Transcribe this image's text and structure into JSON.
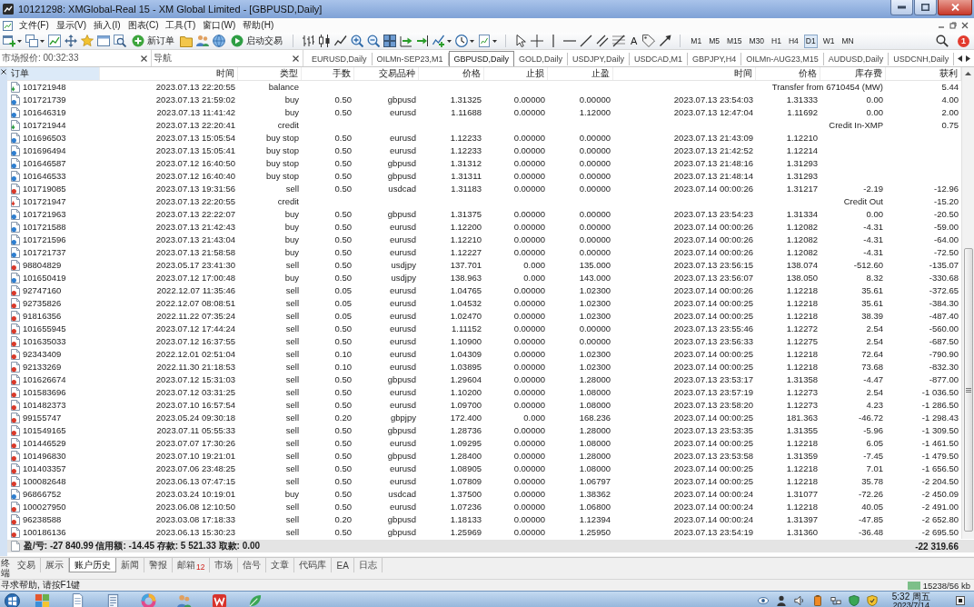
{
  "window": {
    "title": "10121298: XMGlobal-Real 15 - XM Global Limited - [GBPUSD,Daily]"
  },
  "menu": [
    "文件(F)",
    "显示(V)",
    "插入(I)",
    "图表(C)",
    "工具(T)",
    "窗口(W)",
    "帮助(H)"
  ],
  "toolbar": {
    "new_order": "新订单",
    "auto_trading": "启动交易",
    "text_tool": "A",
    "timeframes": [
      {
        "label": "M1",
        "selected": false
      },
      {
        "label": "M5",
        "selected": false
      },
      {
        "label": "M15",
        "selected": false
      },
      {
        "label": "M30",
        "selected": false
      },
      {
        "label": "H1",
        "selected": false
      },
      {
        "label": "H4",
        "selected": false
      },
      {
        "label": "D1",
        "selected": true
      },
      {
        "label": "W1",
        "selected": false
      },
      {
        "label": "MN",
        "selected": false
      }
    ],
    "notifications": "1"
  },
  "panels": [
    {
      "title": "市场报价: 00:32:33"
    },
    {
      "title": "导航"
    }
  ],
  "chart_tabs": [
    {
      "label": "EURUSD,Daily",
      "selected": false
    },
    {
      "label": "OILMn-SEP23,M1",
      "selected": false
    },
    {
      "label": "GBPUSD,Daily",
      "selected": true
    },
    {
      "label": "GOLD,Daily",
      "selected": false
    },
    {
      "label": "USDJPY,Daily",
      "selected": false
    },
    {
      "label": "USDCAD,M1",
      "selected": false
    },
    {
      "label": "GBPJPY,H4",
      "selected": false
    },
    {
      "label": "OILMn-AUG23,M15",
      "selected": false
    },
    {
      "label": "AUDUSD,Daily",
      "selected": false
    },
    {
      "label": "USDCNH,Daily",
      "selected": false
    }
  ],
  "history": {
    "columns": [
      {
        "label": "订单",
        "selected": true
      },
      {
        "label": "时间",
        "selected": false
      },
      {
        "label": "类型",
        "selected": false
      },
      {
        "label": "手数",
        "selected": false
      },
      {
        "label": "交易品种",
        "selected": false
      },
      {
        "label": "价格",
        "selected": false
      },
      {
        "label": "止损",
        "selected": false
      },
      {
        "label": "止盈",
        "selected": false
      },
      {
        "label": "时间",
        "selected": false
      },
      {
        "label": "价格",
        "selected": false
      },
      {
        "label": "库存费",
        "selected": false
      },
      {
        "label": "获利",
        "selected": false
      }
    ],
    "rows": [
      {
        "kind": "deposit",
        "order": "101721948",
        "open_time": "2023.07.13 22:20:55",
        "type": "balance",
        "comment": "Transfer from 6710454 (MW)",
        "profit": "5.44"
      },
      {
        "kind": "buy",
        "order": "101721739",
        "open_time": "2023.07.13 21:59:02",
        "type": "buy",
        "lots": "0.50",
        "symbol": "gbpusd",
        "price": "1.31325",
        "sl": "0.00000",
        "tp": "0.00000",
        "close_time": "2023.07.13 23:54:03",
        "close_price": "1.31333",
        "swap": "0.00",
        "profit": "4.00"
      },
      {
        "kind": "buy",
        "order": "101646319",
        "open_time": "2023.07.13 11:41:42",
        "type": "buy",
        "lots": "0.50",
        "symbol": "eurusd",
        "price": "1.11688",
        "sl": "0.00000",
        "tp": "1.12000",
        "close_time": "2023.07.13 12:47:04",
        "close_price": "1.11692",
        "swap": "0.00",
        "profit": "2.00"
      },
      {
        "kind": "deposit",
        "order": "101721944",
        "open_time": "2023.07.13 22:20:41",
        "type": "credit",
        "comment": "Credit In-XMP",
        "profit": "0.75"
      },
      {
        "kind": "buy",
        "order": "101696503",
        "open_time": "2023.07.13 15:05:54",
        "type": "buy stop",
        "lots": "0.50",
        "symbol": "eurusd",
        "price": "1.12233",
        "sl": "0.00000",
        "tp": "0.00000",
        "close_time": "2023.07.13 21:43:09",
        "close_price": "1.12210"
      },
      {
        "kind": "buy",
        "order": "101696494",
        "open_time": "2023.07.13 15:05:41",
        "type": "buy stop",
        "lots": "0.50",
        "symbol": "eurusd",
        "price": "1.12233",
        "sl": "0.00000",
        "tp": "0.00000",
        "close_time": "2023.07.13 21:42:52",
        "close_price": "1.12214"
      },
      {
        "kind": "buy",
        "order": "101646587",
        "open_time": "2023.07.12 16:40:50",
        "type": "buy stop",
        "lots": "0.50",
        "symbol": "gbpusd",
        "price": "1.31312",
        "sl": "0.00000",
        "tp": "0.00000",
        "close_time": "2023.07.13 21:48:16",
        "close_price": "1.31293"
      },
      {
        "kind": "buy",
        "order": "101646533",
        "open_time": "2023.07.12 16:40:40",
        "type": "buy stop",
        "lots": "0.50",
        "symbol": "gbpusd",
        "price": "1.31311",
        "sl": "0.00000",
        "tp": "0.00000",
        "close_time": "2023.07.13 21:48:14",
        "close_price": "1.31293"
      },
      {
        "kind": "sell",
        "order": "101719085",
        "open_time": "2023.07.13 19:31:56",
        "type": "sell",
        "lots": "0.50",
        "symbol": "usdcad",
        "price": "1.31183",
        "sl": "0.00000",
        "tp": "0.00000",
        "close_time": "2023.07.14 00:00:26",
        "close_price": "1.31217",
        "swap": "-2.19",
        "profit": "-12.96"
      },
      {
        "kind": "withdrawal",
        "order": "101721947",
        "open_time": "2023.07.13 22:20:55",
        "type": "credit",
        "comment": "Credit Out",
        "profit": "-15.20"
      },
      {
        "kind": "buy",
        "order": "101721963",
        "open_time": "2023.07.13 22:22:07",
        "type": "buy",
        "lots": "0.50",
        "symbol": "gbpusd",
        "price": "1.31375",
        "sl": "0.00000",
        "tp": "0.00000",
        "close_time": "2023.07.13 23:54:23",
        "close_price": "1.31334",
        "swap": "0.00",
        "profit": "-20.50"
      },
      {
        "kind": "buy",
        "order": "101721588",
        "open_time": "2023.07.13 21:42:43",
        "type": "buy",
        "lots": "0.50",
        "symbol": "eurusd",
        "price": "1.12200",
        "sl": "0.00000",
        "tp": "0.00000",
        "close_time": "2023.07.14 00:00:26",
        "close_price": "1.12082",
        "swap": "-4.31",
        "profit": "-59.00"
      },
      {
        "kind": "buy",
        "order": "101721596",
        "open_time": "2023.07.13 21:43:04",
        "type": "buy",
        "lots": "0.50",
        "symbol": "eurusd",
        "price": "1.12210",
        "sl": "0.00000",
        "tp": "0.00000",
        "close_time": "2023.07.14 00:00:26",
        "close_price": "1.12082",
        "swap": "-4.31",
        "profit": "-64.00"
      },
      {
        "kind": "buy",
        "order": "101721737",
        "open_time": "2023.07.13 21:58:58",
        "type": "buy",
        "lots": "0.50",
        "symbol": "eurusd",
        "price": "1.12227",
        "sl": "0.00000",
        "tp": "0.00000",
        "close_time": "2023.07.14 00:00:26",
        "close_price": "1.12082",
        "swap": "-4.31",
        "profit": "-72.50"
      },
      {
        "kind": "sell",
        "order": "98804829",
        "open_time": "2023.05.17 23:41:30",
        "type": "sell",
        "lots": "0.50",
        "symbol": "usdjpy",
        "price": "137.701",
        "sl": "0.000",
        "tp": "135.000",
        "close_time": "2023.07.13 23:56:15",
        "close_price": "138.074",
        "swap": "-512.60",
        "profit": "-135.07"
      },
      {
        "kind": "buy",
        "order": "101650419",
        "open_time": "2023.07.12 17:00:48",
        "type": "buy",
        "lots": "0.50",
        "symbol": "usdjpy",
        "price": "138.963",
        "sl": "0.000",
        "tp": "143.000",
        "close_time": "2023.07.13 23:56:07",
        "close_price": "138.050",
        "swap": "8.32",
        "profit": "-330.68"
      },
      {
        "kind": "sell",
        "order": "92747160",
        "open_time": "2022.12.07 11:35:46",
        "type": "sell",
        "lots": "0.05",
        "symbol": "eurusd",
        "price": "1.04765",
        "sl": "0.00000",
        "tp": "1.02300",
        "close_time": "2023.07.14 00:00:26",
        "close_price": "1.12218",
        "swap": "35.61",
        "profit": "-372.65"
      },
      {
        "kind": "sell",
        "order": "92735826",
        "open_time": "2022.12.07 08:08:51",
        "type": "sell",
        "lots": "0.05",
        "symbol": "eurusd",
        "price": "1.04532",
        "sl": "0.00000",
        "tp": "1.02300",
        "close_time": "2023.07.14 00:00:25",
        "close_price": "1.12218",
        "swap": "35.61",
        "profit": "-384.30"
      },
      {
        "kind": "sell",
        "order": "91816356",
        "open_time": "2022.11.22 07:35:24",
        "type": "sell",
        "lots": "0.05",
        "symbol": "eurusd",
        "price": "1.02470",
        "sl": "0.00000",
        "tp": "1.02300",
        "close_time": "2023.07.14 00:00:25",
        "close_price": "1.12218",
        "swap": "38.39",
        "profit": "-487.40"
      },
      {
        "kind": "sell",
        "order": "101655945",
        "open_time": "2023.07.12 17:44:24",
        "type": "sell",
        "lots": "0.50",
        "symbol": "eurusd",
        "price": "1.11152",
        "sl": "0.00000",
        "tp": "0.00000",
        "close_time": "2023.07.13 23:55:46",
        "close_price": "1.12272",
        "swap": "2.54",
        "profit": "-560.00"
      },
      {
        "kind": "sell",
        "order": "101635033",
        "open_time": "2023.07.12 16:37:55",
        "type": "sell",
        "lots": "0.50",
        "symbol": "eurusd",
        "price": "1.10900",
        "sl": "0.00000",
        "tp": "0.00000",
        "close_time": "2023.07.13 23:56:33",
        "close_price": "1.12275",
        "swap": "2.54",
        "profit": "-687.50"
      },
      {
        "kind": "sell",
        "order": "92343409",
        "open_time": "2022.12.01 02:51:04",
        "type": "sell",
        "lots": "0.10",
        "symbol": "eurusd",
        "price": "1.04309",
        "sl": "0.00000",
        "tp": "1.02300",
        "close_time": "2023.07.14 00:00:25",
        "close_price": "1.12218",
        "swap": "72.64",
        "profit": "-790.90"
      },
      {
        "kind": "sell",
        "order": "92133269",
        "open_time": "2022.11.30 21:18:53",
        "type": "sell",
        "lots": "0.10",
        "symbol": "eurusd",
        "price": "1.03895",
        "sl": "0.00000",
        "tp": "1.02300",
        "close_time": "2023.07.14 00:00:25",
        "close_price": "1.12218",
        "swap": "73.68",
        "profit": "-832.30"
      },
      {
        "kind": "sell",
        "order": "101626674",
        "open_time": "2023.07.12 15:31:03",
        "type": "sell",
        "lots": "0.50",
        "symbol": "gbpusd",
        "price": "1.29604",
        "sl": "0.00000",
        "tp": "1.28000",
        "close_time": "2023.07.13 23:53:17",
        "close_price": "1.31358",
        "swap": "-4.47",
        "profit": "-877.00"
      },
      {
        "kind": "sell",
        "order": "101583696",
        "open_time": "2023.07.12 03:31:25",
        "type": "sell",
        "lots": "0.50",
        "symbol": "eurusd",
        "price": "1.10200",
        "sl": "0.00000",
        "tp": "1.08000",
        "close_time": "2023.07.13 23:57:19",
        "close_price": "1.12273",
        "swap": "2.54",
        "profit": "-1 036.50"
      },
      {
        "kind": "sell",
        "order": "101482373",
        "open_time": "2023.07.10 16:57:54",
        "type": "sell",
        "lots": "0.50",
        "symbol": "eurusd",
        "price": "1.09700",
        "sl": "0.00000",
        "tp": "1.08000",
        "close_time": "2023.07.13 23:58:20",
        "close_price": "1.12273",
        "swap": "4.23",
        "profit": "-1 286.50"
      },
      {
        "kind": "sell",
        "order": "99155747",
        "open_time": "2023.05.24 09:30:18",
        "type": "sell",
        "lots": "0.20",
        "symbol": "gbpjpy",
        "price": "172.400",
        "sl": "0.000",
        "tp": "168.236",
        "close_time": "2023.07.14 00:00:25",
        "close_price": "181.363",
        "swap": "-46.72",
        "profit": "-1 298.43"
      },
      {
        "kind": "sell",
        "order": "101549165",
        "open_time": "2023.07.11 05:55:33",
        "type": "sell",
        "lots": "0.50",
        "symbol": "gbpusd",
        "price": "1.28736",
        "sl": "0.00000",
        "tp": "1.28000",
        "close_time": "2023.07.13 23:53:35",
        "close_price": "1.31355",
        "swap": "-5.96",
        "profit": "-1 309.50"
      },
      {
        "kind": "sell",
        "order": "101446529",
        "open_time": "2023.07.07 17:30:26",
        "type": "sell",
        "lots": "0.50",
        "symbol": "eurusd",
        "price": "1.09295",
        "sl": "0.00000",
        "tp": "1.08000",
        "close_time": "2023.07.14 00:00:25",
        "close_price": "1.12218",
        "swap": "6.05",
        "profit": "-1 461.50"
      },
      {
        "kind": "sell",
        "order": "101496830",
        "open_time": "2023.07.10 19:21:01",
        "type": "sell",
        "lots": "0.50",
        "symbol": "gbpusd",
        "price": "1.28400",
        "sl": "0.00000",
        "tp": "1.28000",
        "close_time": "2023.07.13 23:53:58",
        "close_price": "1.31359",
        "swap": "-7.45",
        "profit": "-1 479.50"
      },
      {
        "kind": "sell",
        "order": "101403357",
        "open_time": "2023.07.06 23:48:25",
        "type": "sell",
        "lots": "0.50",
        "symbol": "eurusd",
        "price": "1.08905",
        "sl": "0.00000",
        "tp": "1.08000",
        "close_time": "2023.07.14 00:00:25",
        "close_price": "1.12218",
        "swap": "7.01",
        "profit": "-1 656.50"
      },
      {
        "kind": "sell",
        "order": "100082648",
        "open_time": "2023.06.13 07:47:15",
        "type": "sell",
        "lots": "0.50",
        "symbol": "eurusd",
        "price": "1.07809",
        "sl": "0.00000",
        "tp": "1.06797",
        "close_time": "2023.07.14 00:00:25",
        "close_price": "1.12218",
        "swap": "35.78",
        "profit": "-2 204.50"
      },
      {
        "kind": "buy",
        "order": "96866752",
        "open_time": "2023.03.24 10:19:01",
        "type": "buy",
        "lots": "0.50",
        "symbol": "usdcad",
        "price": "1.37500",
        "sl": "0.00000",
        "tp": "1.38362",
        "close_time": "2023.07.14 00:00:24",
        "close_price": "1.31077",
        "swap": "-72.26",
        "profit": "-2 450.09"
      },
      {
        "kind": "sell",
        "order": "100027950",
        "open_time": "2023.06.08 12:10:50",
        "type": "sell",
        "lots": "0.50",
        "symbol": "eurusd",
        "price": "1.07236",
        "sl": "0.00000",
        "tp": "1.06800",
        "close_time": "2023.07.14 00:00:24",
        "close_price": "1.12218",
        "swap": "40.05",
        "profit": "-2 491.00"
      },
      {
        "kind": "sell",
        "order": "96238588",
        "open_time": "2023.03.08 17:18:33",
        "type": "sell",
        "lots": "0.20",
        "symbol": "gbpusd",
        "price": "1.18133",
        "sl": "0.00000",
        "tp": "1.12394",
        "close_time": "2023.07.14 00:00:24",
        "close_price": "1.31397",
        "swap": "-47.85",
        "profit": "-2 652.80"
      },
      {
        "kind": "sell",
        "order": "100186136",
        "open_time": "2023.06.13 15:30:23",
        "type": "sell",
        "lots": "0.50",
        "symbol": "gbpusd",
        "price": "1.25969",
        "sl": "0.00000",
        "tp": "1.25950",
        "close_time": "2023.07.13 23:54:19",
        "close_price": "1.31360",
        "swap": "-36.48",
        "profit": "-2 695.50"
      }
    ],
    "summary": "盈/亏: -27 840.99 信用额: -14.45 存款: 5 521.33 取款: 0.00",
    "total": "-22 319.66"
  },
  "terminal": {
    "label": "终端",
    "tabs": [
      {
        "label": "交易",
        "selected": false
      },
      {
        "label": "展示",
        "selected": false
      },
      {
        "label": "账户历史",
        "selected": true
      },
      {
        "label": "新闻",
        "selected": false
      },
      {
        "label": "警报",
        "selected": false
      },
      {
        "label": "邮箱",
        "badge": "12",
        "selected": false
      },
      {
        "label": "市场",
        "selected": false
      },
      {
        "label": "信号",
        "selected": false
      },
      {
        "label": "文章",
        "selected": false
      },
      {
        "label": "代码库",
        "selected": false
      },
      {
        "label": "EA",
        "selected": false
      },
      {
        "label": "日志",
        "selected": false
      }
    ]
  },
  "status_bar": {
    "help": "寻求帮助, 请按F1键",
    "traffic": "15238/56 kb"
  },
  "taskbar": {
    "time": "5:32 周五",
    "date": "2023/7/14"
  }
}
